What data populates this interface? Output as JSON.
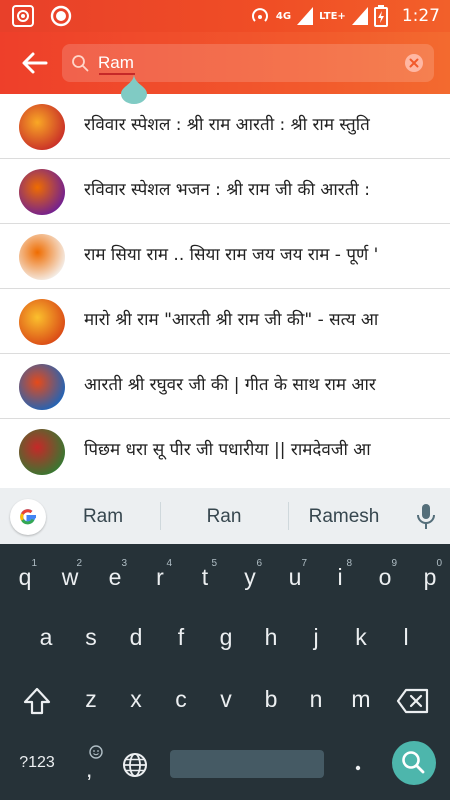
{
  "status_bar": {
    "network": "4G",
    "lte": "LTE+",
    "time": "1:27"
  },
  "search": {
    "query": "Ram"
  },
  "results": [
    {
      "title": "रविवार स्पेशल : श्री राम आरती : श्री राम स्तुति",
      "thumb_colors": [
        "#c62828",
        "#f9a825"
      ]
    },
    {
      "title": "रविवार स्पेशल भजन : श्री राम जी की आरती : ",
      "thumb_colors": [
        "#6a1b9a",
        "#ef6c00"
      ]
    },
    {
      "title": "राम सिया राम .. सिया राम जय जय राम - पूर्ण '",
      "thumb_colors": [
        "#f5f5f5",
        "#ef6c00"
      ]
    },
    {
      "title": "मारो श्री राम \"आरती श्री राम जी की\" - सत्य आ",
      "thumb_colors": [
        "#d84315",
        "#fbc02d"
      ]
    },
    {
      "title": "आरती श्री रघुवर जी की | गीत के साथ राम आर",
      "thumb_colors": [
        "#1565c0",
        "#e64a19"
      ]
    },
    {
      "title": "पिछम धरा सू पीर जी पधारीया || रामदेवजी आ",
      "thumb_colors": [
        "#2e7d32",
        "#c62828"
      ]
    }
  ],
  "keyboard": {
    "suggestions": [
      "Ram",
      "Ran",
      "Ramesh"
    ],
    "row1": [
      "q",
      "w",
      "e",
      "r",
      "t",
      "y",
      "u",
      "i",
      "o",
      "p"
    ],
    "row1_hints": [
      "1",
      "2",
      "3",
      "4",
      "5",
      "6",
      "7",
      "8",
      "9",
      "0"
    ],
    "row2": [
      "a",
      "s",
      "d",
      "f",
      "g",
      "h",
      "j",
      "k",
      "l"
    ],
    "row3": [
      "z",
      "x",
      "c",
      "v",
      "b",
      "n",
      "m"
    ],
    "symbols_key": "?123",
    "comma": ","
  },
  "colors": {
    "accent": "#f04e25",
    "keyboard_bg": "#263238",
    "go_key": "#4db6ac"
  }
}
